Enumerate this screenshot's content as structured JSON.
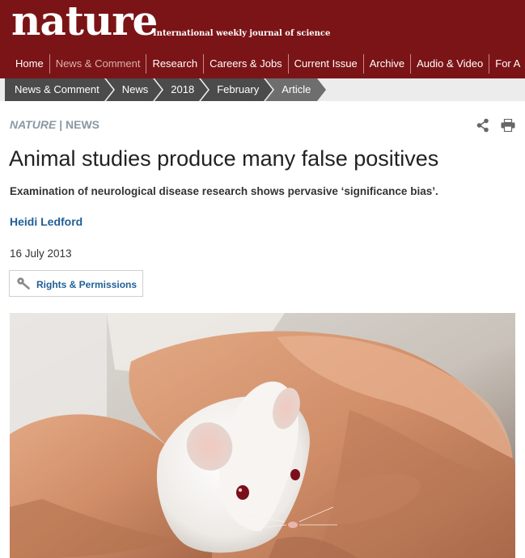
{
  "masthead": {
    "logo": "nature",
    "tagline": "International weekly journal of science",
    "bg_color": "#7b1416"
  },
  "nav": {
    "items": [
      {
        "label": "Home"
      },
      {
        "label": "News & Comment"
      },
      {
        "label": "Research"
      },
      {
        "label": "Careers & Jobs"
      },
      {
        "label": "Current Issue"
      },
      {
        "label": "Archive"
      },
      {
        "label": "Audio & Video"
      },
      {
        "label": "For A"
      }
    ]
  },
  "breadcrumb": {
    "items": [
      "News & Comment",
      "News",
      "2018",
      "February",
      "Article"
    ]
  },
  "article": {
    "source": "NATURE",
    "separator": "|",
    "section": "NEWS",
    "title": "Animal studies produce many false positives",
    "standfirst": "Examination of neurological disease research shows pervasive ‘significance bias’.",
    "author": "Heidi Ledford",
    "date": "16 July 2013",
    "rights_label": "Rights & Permissions"
  },
  "icons": {
    "share": "share-icon",
    "print": "print-icon",
    "rights": "key-icon"
  },
  "colors": {
    "link": "#1f5f96",
    "crumb": "#4b4b4b",
    "section_label": "#8a98a4"
  }
}
